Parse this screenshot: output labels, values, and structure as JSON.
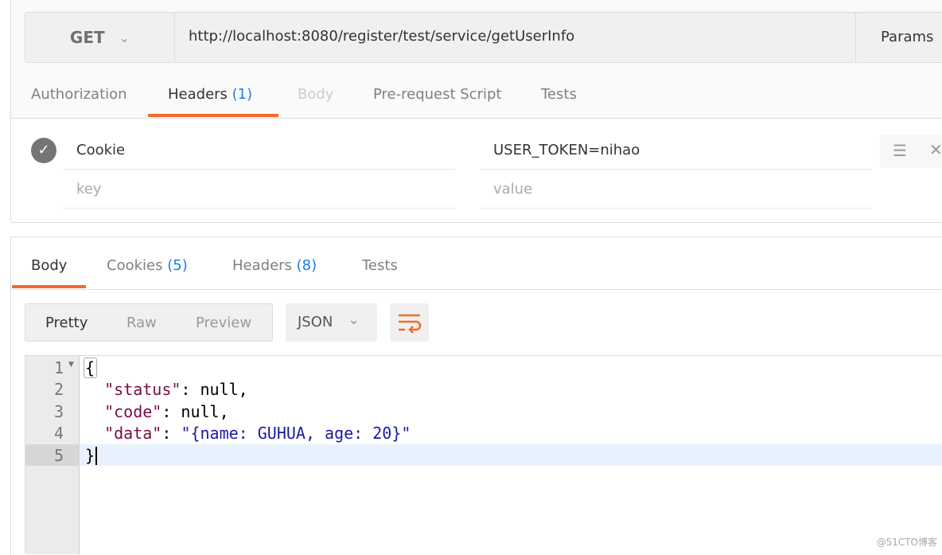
{
  "request": {
    "method": "GET",
    "url": "http://localhost:8080/register/test/service/getUserInfo",
    "params_label": "Params",
    "tabs": [
      {
        "label": "Authorization"
      },
      {
        "label": "Headers",
        "count": "(1)",
        "active": true
      },
      {
        "label": "Body",
        "disabled": true
      },
      {
        "label": "Pre-request Script"
      },
      {
        "label": "Tests"
      }
    ],
    "headers": [
      {
        "key": "Cookie",
        "value": "USER_TOKEN=nihao",
        "enabled": true
      }
    ],
    "key_placeholder": "key",
    "value_placeholder": "value"
  },
  "response": {
    "tabs": [
      {
        "label": "Body",
        "active": true
      },
      {
        "label": "Cookies",
        "count": "(5)"
      },
      {
        "label": "Headers",
        "count": "(8)"
      },
      {
        "label": "Tests"
      }
    ],
    "view_modes": [
      "Pretty",
      "Raw",
      "Preview"
    ],
    "active_view": "Pretty",
    "format": "JSON",
    "lines": [
      {
        "n": "1",
        "parts": [
          {
            "t": "{",
            "c": ""
          }
        ]
      },
      {
        "n": "2",
        "parts": [
          {
            "t": "  ",
            "c": ""
          },
          {
            "t": "\"status\"",
            "c": "k"
          },
          {
            "t": ": null,",
            "c": ""
          }
        ]
      },
      {
        "n": "3",
        "parts": [
          {
            "t": "  ",
            "c": ""
          },
          {
            "t": "\"code\"",
            "c": "k"
          },
          {
            "t": ": null,",
            "c": ""
          }
        ]
      },
      {
        "n": "4",
        "parts": [
          {
            "t": "  ",
            "c": ""
          },
          {
            "t": "\"data\"",
            "c": "k"
          },
          {
            "t": ": ",
            "c": ""
          },
          {
            "t": "\"{name: GUHUA, age: 20}\"",
            "c": "s"
          }
        ]
      },
      {
        "n": "5",
        "parts": [
          {
            "t": "}",
            "c": ""
          }
        ]
      }
    ]
  },
  "watermark": "@51CTO博客",
  "colors": {
    "accent": "#f26b2a",
    "count": "#1d7de8"
  }
}
